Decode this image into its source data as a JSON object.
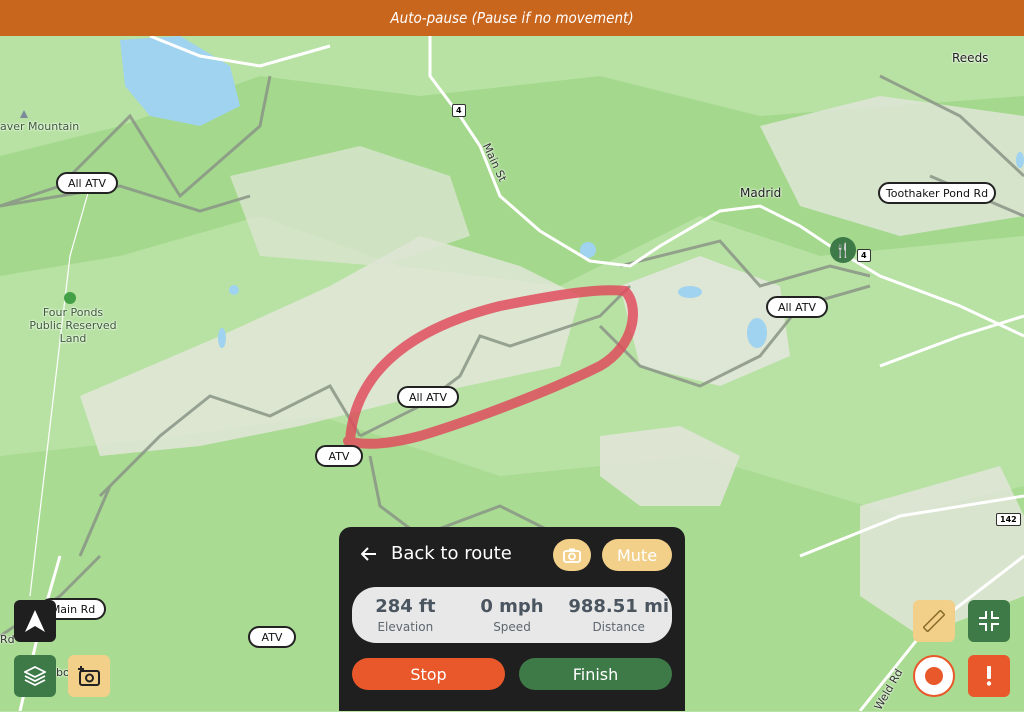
{
  "banner": {
    "text": "Auto-pause (Pause if no movement)"
  },
  "map": {
    "labels": {
      "place_mountain": "aver Mountain",
      "place_reeds": "Reeds",
      "place_madrid": "Madrid",
      "place_four_ponds": "Four Ponds Public Reserved Land",
      "road_main_st": "Main St",
      "road_weld": "Weld Rd",
      "partial_left": "Rd",
      "partial_bottom": "bo"
    },
    "shields": {
      "route4_a": "4",
      "route4_b": "4",
      "route142": "142"
    },
    "trail_pills": {
      "all_atv_1": "All ATV",
      "all_atv_2": "All ATV",
      "all_atv_3": "All ATV",
      "atv_1": "ATV",
      "atv_2": "ATV",
      "toothaker": "Toothaker Pond Rd",
      "main_rd": "Main Rd"
    },
    "colors": {
      "track": "#e0485a",
      "water": "#9fd3ef",
      "forest": "#a7dc8f",
      "clearing": "#e7e7df"
    }
  },
  "panel": {
    "back_label": "Back to route",
    "mute_label": "Mute",
    "stats": [
      {
        "value": "284 ft",
        "label": "Elevation"
      },
      {
        "value": "0 mph",
        "label": "Speed"
      },
      {
        "value": "988.51 mi",
        "label": "Distance"
      }
    ],
    "stop_label": "Stop",
    "finish_label": "Finish"
  },
  "icons": {
    "navigate": "navigation-arrow-icon",
    "layers": "layers-icon",
    "add_photo": "add-photo-icon",
    "ruler": "ruler-icon",
    "collapse": "collapse-icon",
    "record": "record-icon",
    "alert": "alert-icon",
    "restaurant": "restaurant-icon",
    "camera": "camera-icon",
    "back_arrow": "back-arrow-icon"
  }
}
